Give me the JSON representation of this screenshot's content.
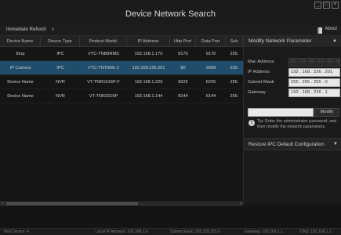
{
  "window": {
    "title": "Device Network Search",
    "btn_min": "_",
    "btn_max": "□",
    "btn_close": "×"
  },
  "toolbar": {
    "refresh_dropdown": "Immediate Refresh",
    "about_label": "About"
  },
  "table": {
    "columns": [
      "Device Name",
      "Device Type",
      "Product Model",
      "IP Address",
      "Http Port",
      "Data Port",
      "Sub"
    ],
    "rows": [
      [
        "8mp",
        "IPC",
        "VTC-TNB8RMS",
        "192.168.1.170",
        "8170",
        "9170",
        "255."
      ],
      [
        "IP Camera",
        "IPC",
        "VTC-TNT5RE-2",
        "192.168.226.201",
        "80",
        "9008",
        "255."
      ],
      [
        "Device Name",
        "NVR",
        "VT-TNR1616P-F",
        "192.168.1.225",
        "8225",
        "6225",
        "255."
      ],
      [
        "Device Name",
        "NVR",
        "VT-TNR3216P",
        "192.168.1.144",
        "8144",
        "6144",
        "255."
      ]
    ],
    "selected_row": 1
  },
  "panel": {
    "title": "Modify Network Parameter",
    "fields": [
      {
        "label": "Mac Address",
        "value": "00 - 23 - 45 - 13 - 00 - 00"
      },
      {
        "label": "IP Address",
        "value": "192 . 168 . 226 . 201"
      },
      {
        "label": "Subnet Mask",
        "value": "255 . 255 . 255 . 0"
      },
      {
        "label": "Gateway",
        "value": "192 . 168 . 226 . 1"
      }
    ],
    "modify_button": "Modify",
    "tip_icon": "!",
    "tip": "Tip: Enter the administrator password, and then modify the network parameters.",
    "restore_label": "Restore IPC Default Configuration"
  },
  "status": {
    "total": "Total Device: 4",
    "local_ip": "Local IP Address: 192.168.1.6",
    "subnet": "Subnet Mask: 255.255.255.0",
    "gateway": "Gateway: 192.168.1.1",
    "dns": "DNS: 192.168.1.1"
  }
}
